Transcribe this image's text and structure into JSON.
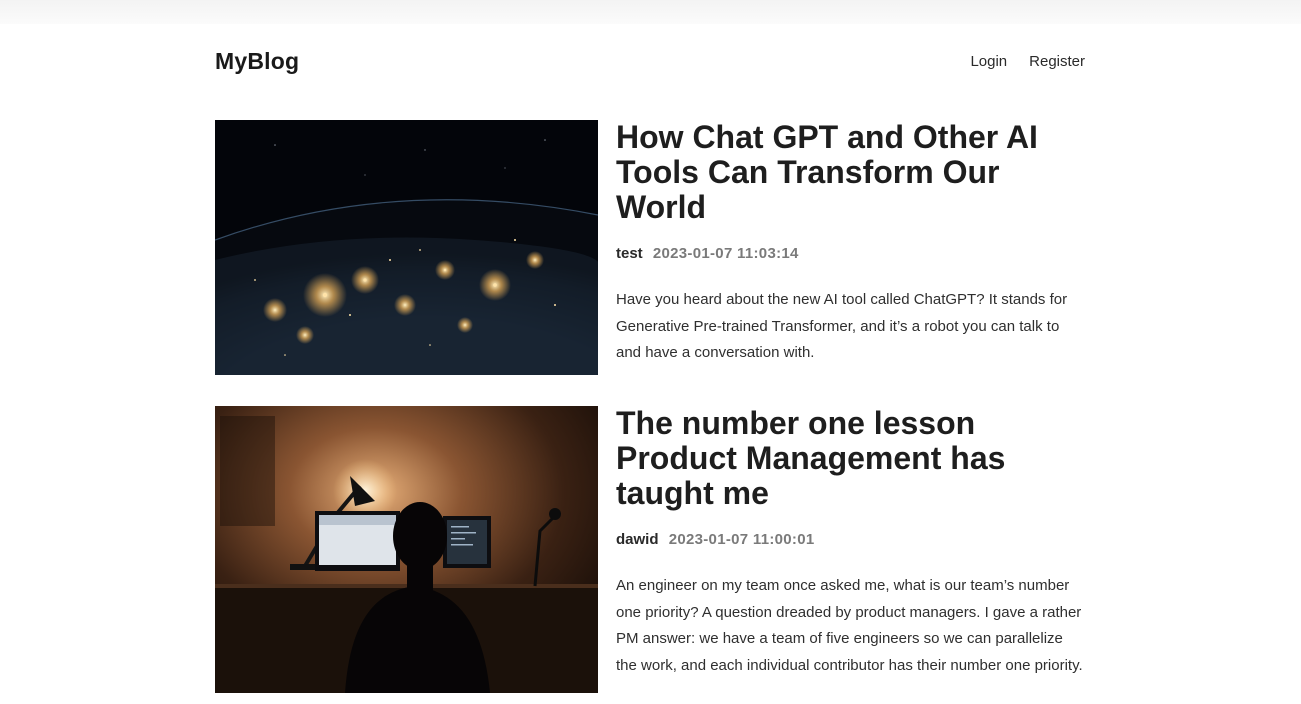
{
  "header": {
    "logo": "MyBlog",
    "nav": {
      "login": "Login",
      "register": "Register"
    }
  },
  "posts": [
    {
      "title": "How Chat GPT and Other AI Tools Can Transform Our World",
      "author": "test",
      "date": "2023-01-07 11:03:14",
      "excerpt": "Have you heard about the new AI tool called ChatGPT? It stands for Generative Pre-trained Transformer, and it’s a robot you can talk to and have a conversation with.",
      "image": "earth-at-night-from-space"
    },
    {
      "title": "The number one lesson Product Management has taught me",
      "author": "dawid",
      "date": "2023-01-07 11:00:01",
      "excerpt": "An engineer on my team once asked me, what is our team’s number one priority? A question dreaded by product managers. I gave a rather PM answer: we have a team of five engineers so we can parallelize the work, and each individual contributor has their number one priority.",
      "image": "person-at-computer-desk-dark-room"
    }
  ]
}
